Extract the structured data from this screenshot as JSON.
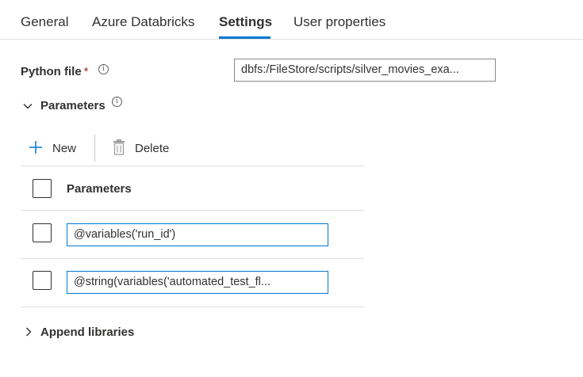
{
  "tabs": [
    {
      "label": "General"
    },
    {
      "label": "Azure Databricks"
    },
    {
      "label": "Settings",
      "active": true
    },
    {
      "label": "User properties"
    }
  ],
  "python_file": {
    "label": "Python file",
    "required_mark": "*",
    "info_glyph": "i",
    "value": "dbfs:/FileStore/scripts/silver_movies_exa..."
  },
  "parameters_section": {
    "label": "Parameters",
    "expanded": true,
    "info_glyph": "i",
    "toolbar": {
      "new_label": "New",
      "delete_label": "Delete"
    },
    "table": {
      "header": "Parameters",
      "rows": [
        {
          "value": "@variables('run_id')"
        },
        {
          "value": "@string(variables('automated_test_fl..."
        }
      ]
    }
  },
  "append_libraries": {
    "label": "Append libraries",
    "expanded": false
  },
  "colors": {
    "accent": "#0078d4",
    "required": "#a4262c"
  }
}
